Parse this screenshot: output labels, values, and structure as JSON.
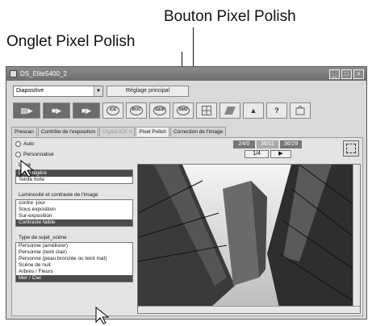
{
  "callouts": {
    "pixel_polish_button": "Bouton Pixel Polish",
    "pixel_polish_tab": "Onglet Pixel Polish"
  },
  "window": {
    "title": "DS_Elite5400_2",
    "controls": [
      "_",
      "□",
      "×"
    ]
  },
  "toolbar": {
    "film_type": "Diapositive",
    "main_settings": "Réglage principal",
    "help": "?",
    "icons": [
      "scan-index-icon",
      "prescan-icon",
      "scan-icon",
      "ice-icon",
      "roc-icon",
      "gem-icon",
      "smd-icon",
      "grid-icon",
      "pixel-polish-icon",
      "eject-icon",
      "help-icon",
      "preferences-icon"
    ]
  },
  "tabs": [
    {
      "label": "Prescan",
      "state": "normal"
    },
    {
      "label": "Contrôle de l'exposition",
      "state": "normal"
    },
    {
      "label": "Digital ICE 4",
      "state": "disabled"
    },
    {
      "label": "Pixel Polish",
      "state": "active"
    },
    {
      "label": "Correction de l'image",
      "state": "normal"
    }
  ],
  "left": {
    "auto": "Auto",
    "custom": "Personnalisé",
    "group1_label": "Lissé",
    "group1_items": [
      "Lissé légère",
      "Teinte forte"
    ],
    "group1_selected": 0,
    "group2_label": "Luminosité et contraste de l'image",
    "group2_items": [
      "contre -jour",
      "Sous exposition",
      "Sur-exposition",
      "Contraste faible"
    ],
    "group2_selected": 3,
    "group3_label": "Type de sujet_scène",
    "group3_items": [
      "Personne (améliorer)",
      "Personne (teint clair)",
      "Personne (peau bronzée ou teint mat)",
      "Scène de nuit",
      "Arbres / Fleurs",
      "Mer / Ciel"
    ],
    "group3_selected": 5
  },
  "frame_controls": {
    "counters": [
      "24/0",
      "36/11",
      "36/29"
    ],
    "page": "1/4",
    "next": "▶"
  },
  "colors": {
    "window_bg": "#d9d9d9",
    "selection": "#4b4b4b"
  }
}
